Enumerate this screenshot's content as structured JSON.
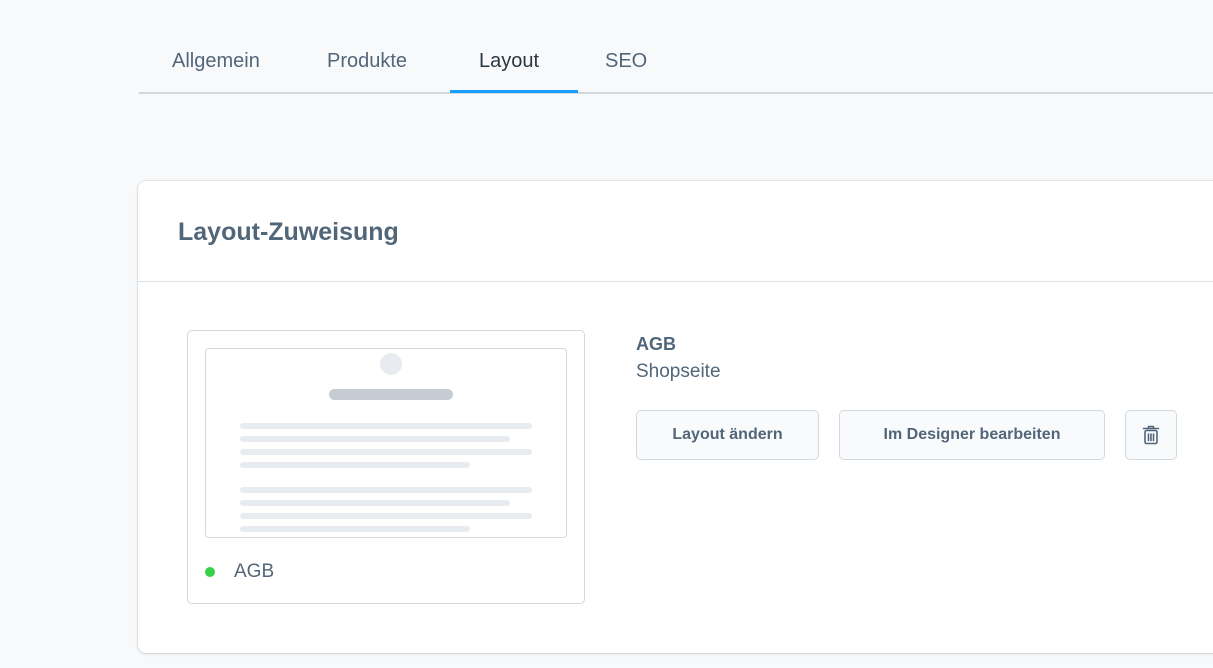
{
  "tabs": [
    {
      "label": "Allgemein",
      "active": false
    },
    {
      "label": "Produkte",
      "active": false
    },
    {
      "label": "Layout",
      "active": true
    },
    {
      "label": "SEO",
      "active": false
    }
  ],
  "card": {
    "title": "Layout-Zuweisung"
  },
  "preview": {
    "name": "AGB",
    "status_color": "#37d046"
  },
  "layout_info": {
    "name": "AGB",
    "type": "Shopseite"
  },
  "buttons": {
    "change_layout": "Layout ändern",
    "edit_in_designer": "Im Designer bearbeiten",
    "delete_icon": "trash-icon"
  },
  "colors": {
    "accent": "#189eff",
    "text": "#52667a",
    "background": "#f8f9fa"
  }
}
